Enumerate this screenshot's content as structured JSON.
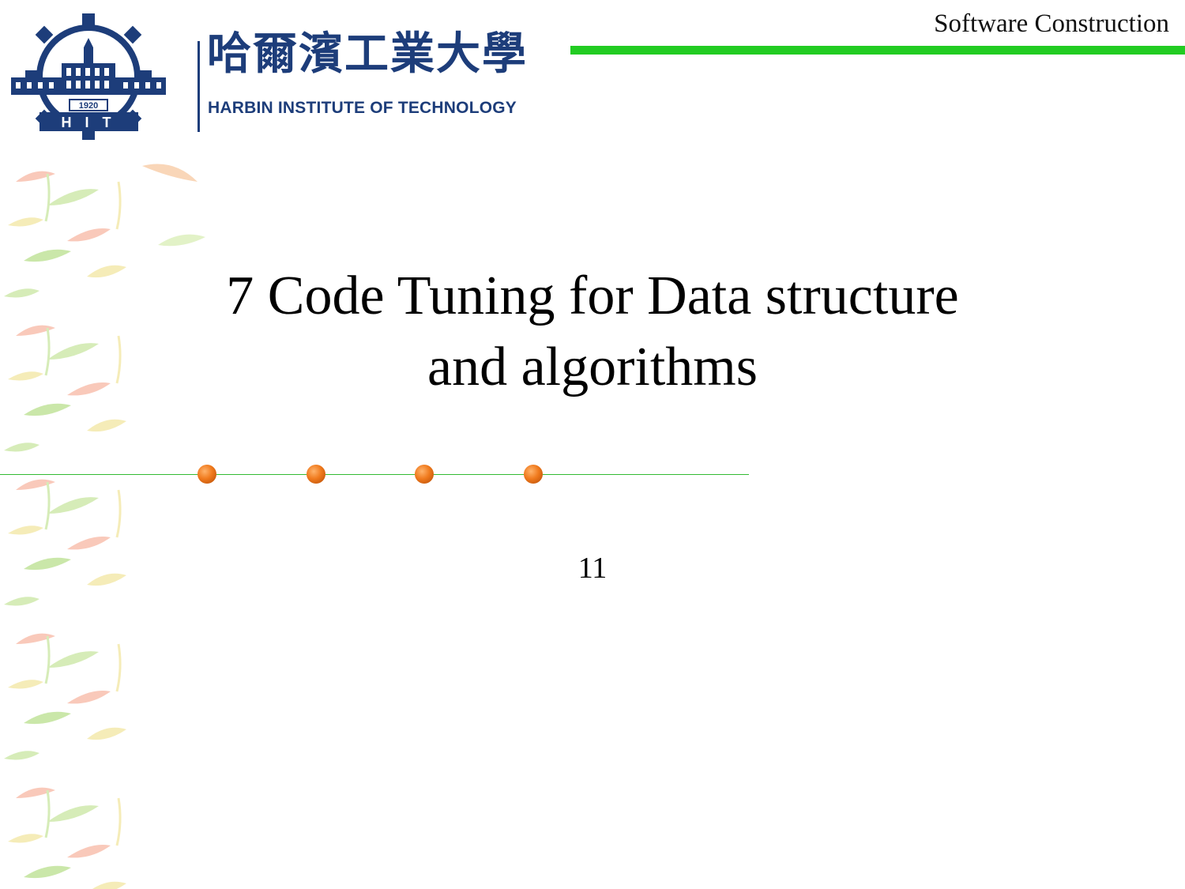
{
  "header": {
    "course_title": "Software Construction",
    "accent_color": "#22cc22"
  },
  "logo": {
    "name_cn": "哈爾濱工業大學",
    "name_en": "HARBIN INSTITUTE OF TECHNOLOGY",
    "emblem_year": "1920",
    "emblem_letters": "H I T",
    "brand_color": "#1d3d7a"
  },
  "slide": {
    "title_line1": "7 Code Tuning for Data structure",
    "title_line2": "and algorithms",
    "page_number": "11"
  },
  "decor": {
    "bullet_color": "#f07a1d",
    "line_color": "#33bb33"
  }
}
